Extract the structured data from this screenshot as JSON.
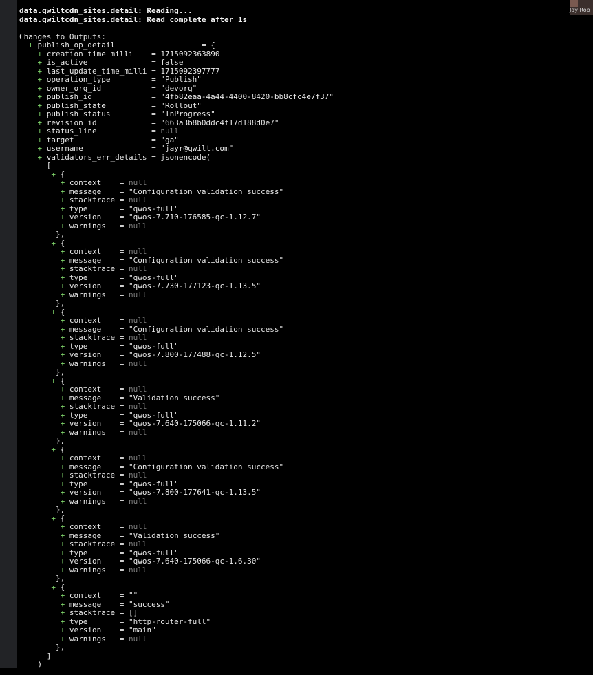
{
  "participant": {
    "name": "Jay Rob"
  },
  "status_lines": [
    "data.qwiltcdn_sites.detail: Reading...",
    "data.qwiltcdn_sites.detail: Read complete after 1s"
  ],
  "header": "Changes to Outputs:",
  "output_name": "publish_op_detail",
  "open_brace": "= {",
  "fields": [
    {
      "key": "creation_time_milli",
      "value": "1715092363890",
      "is_null": false
    },
    {
      "key": "is_active",
      "value": "false",
      "is_null": false
    },
    {
      "key": "last_update_time_milli",
      "value": "1715092397777",
      "is_null": false
    },
    {
      "key": "operation_type",
      "value": "\"Publish\"",
      "is_null": false
    },
    {
      "key": "owner_org_id",
      "value": "\"devorg\"",
      "is_null": false
    },
    {
      "key": "publish_id",
      "value": "\"4fb82eaa-4a44-4400-8420-bb8cfc4e7f37\"",
      "is_null": false
    },
    {
      "key": "publish_state",
      "value": "\"Rollout\"",
      "is_null": false
    },
    {
      "key": "publish_status",
      "value": "\"InProgress\"",
      "is_null": false
    },
    {
      "key": "revision_id",
      "value": "\"663a3b8b0ddc4f17d188d0e7\"",
      "is_null": false
    },
    {
      "key": "status_line",
      "value": "null",
      "is_null": true
    },
    {
      "key": "target",
      "value": "\"ga\"",
      "is_null": false
    },
    {
      "key": "username",
      "value": "\"jayr@qwilt.com\"",
      "is_null": false
    },
    {
      "key": "validators_err_details",
      "value": "jsonencode(",
      "is_null": false
    }
  ],
  "array_open": "[",
  "array_close": "]",
  "paren_close": ")",
  "entries": [
    {
      "context": "null",
      "message": "\"Configuration validation success\"",
      "stacktrace": "null",
      "type": "\"qwos-full\"",
      "version": "\"qwos-7.710-176585-qc-1.12.7\"",
      "warnings": "null"
    },
    {
      "context": "null",
      "message": "\"Configuration validation success\"",
      "stacktrace": "null",
      "type": "\"qwos-full\"",
      "version": "\"qwos-7.730-177123-qc-1.13.5\"",
      "warnings": "null"
    },
    {
      "context": "null",
      "message": "\"Configuration validation success\"",
      "stacktrace": "null",
      "type": "\"qwos-full\"",
      "version": "\"qwos-7.800-177488-qc-1.12.5\"",
      "warnings": "null"
    },
    {
      "context": "null",
      "message": "\"Validation success\"",
      "stacktrace": "null",
      "type": "\"qwos-full\"",
      "version": "\"qwos-7.640-175066-qc-1.11.2\"",
      "warnings": "null"
    },
    {
      "context": "null",
      "message": "\"Configuration validation success\"",
      "stacktrace": "null",
      "type": "\"qwos-full\"",
      "version": "\"qwos-7.800-177641-qc-1.13.5\"",
      "warnings": "null"
    },
    {
      "context": "null",
      "message": "\"Validation success\"",
      "stacktrace": "null",
      "type": "\"qwos-full\"",
      "version": "\"qwos-7.640-175066-qc-1.6.30\"",
      "warnings": "null"
    },
    {
      "context": "\"\"",
      "message": "\"success\"",
      "stacktrace": "[]",
      "type": "\"http-router-full\"",
      "version": "\"main\"",
      "warnings": "null"
    }
  ],
  "colors": {
    "background": "#000000",
    "plus": "#7fd36a",
    "null": "#7d7d7d",
    "text": "#e6e6e6"
  }
}
